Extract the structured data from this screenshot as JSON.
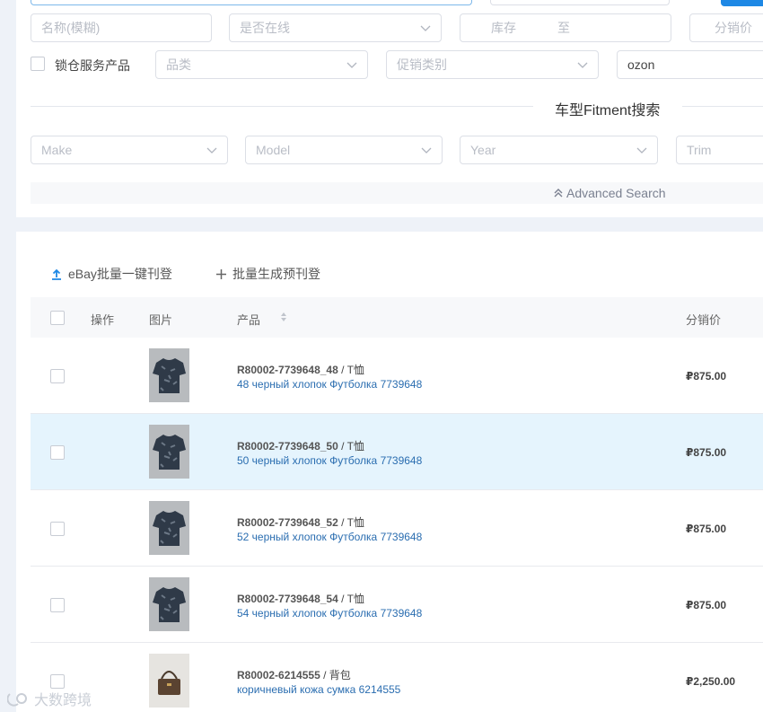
{
  "filters": {
    "name_placeholder": "名称(模糊)",
    "online_placeholder": "是否在线",
    "stock_label": "库存",
    "stock_to": "至",
    "distribution_price_label": "分销价",
    "lock_service_label": "锁仓服务产品",
    "category_placeholder": "品类",
    "promo_placeholder": "促销类别",
    "platform_value": "ozon"
  },
  "fitment": {
    "title": "车型Fitment搜索",
    "make_placeholder": "Make",
    "model_placeholder": "Model",
    "year_placeholder": "Year",
    "trim_placeholder": "Trim",
    "advanced_label": "Advanced Search"
  },
  "actions": {
    "ebay_batch_label": "eBay批量一键刊登",
    "batch_preview_label": "批量生成预刊登"
  },
  "table": {
    "headers": {
      "operation": "操作",
      "image": "图片",
      "product": "产品",
      "distribution_price": "分销价"
    },
    "rows": [
      {
        "sku": "R80002-7739648_48",
        "category": " / T恤",
        "name": "48 черный хлопок Футболка 7739648",
        "price": "₽875.00",
        "highlighted": false,
        "image": "tshirt"
      },
      {
        "sku": "R80002-7739648_50",
        "category": " / T恤",
        "name": "50 черный хлопок Футболка 7739648",
        "price": "₽875.00",
        "highlighted": true,
        "image": "tshirt"
      },
      {
        "sku": "R80002-7739648_52",
        "category": " / T恤",
        "name": "52 черный хлопок Футболка 7739648",
        "price": "₽875.00",
        "highlighted": false,
        "image": "tshirt"
      },
      {
        "sku": "R80002-7739648_54",
        "category": " / T恤",
        "name": "54 черный хлопок Футболка 7739648",
        "price": "₽875.00",
        "highlighted": false,
        "image": "tshirt"
      },
      {
        "sku": "R80002-6214555",
        "category": " / 背包",
        "name": "коричневый кожа сумка 6214555",
        "price": "₽2,250.00",
        "highlighted": false,
        "image": "bag"
      }
    ]
  },
  "watermark": "大数跨境",
  "colors": {
    "accent": "#1e88e5",
    "link": "#2a6db0",
    "highlight_row": "#e5f4fd"
  }
}
